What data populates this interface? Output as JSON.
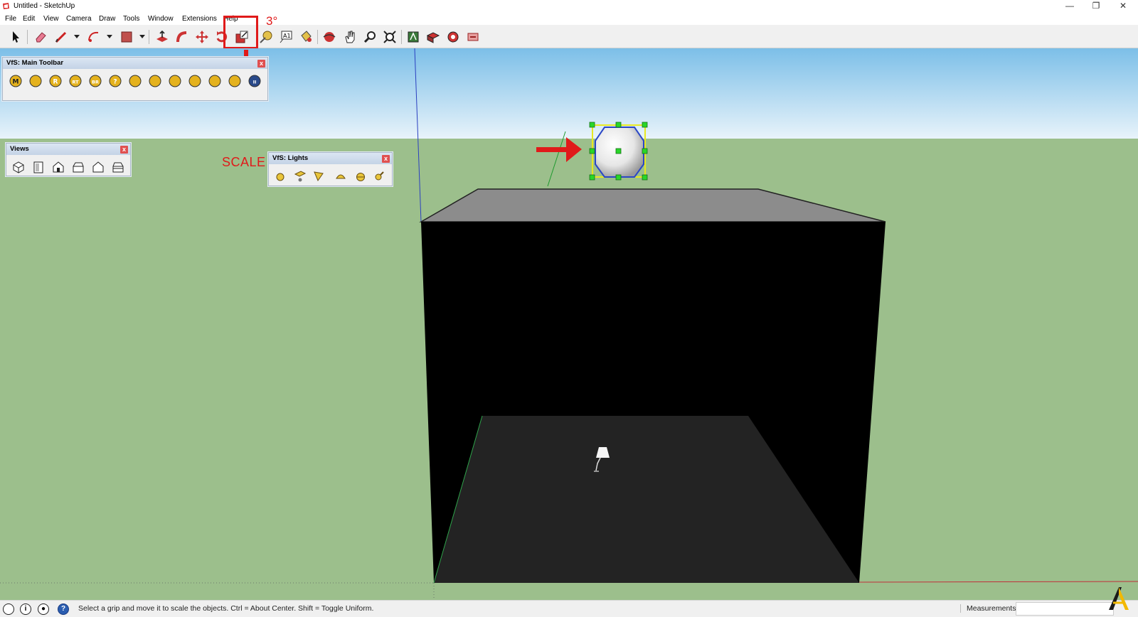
{
  "window": {
    "title": "Untitled - SketchUp",
    "controls": {
      "minimize": "—",
      "restore": "❐",
      "close": "✕"
    }
  },
  "menu": {
    "items": [
      "File",
      "Edit",
      "View",
      "Camera",
      "Draw",
      "Tools",
      "Window",
      "Extensions",
      "Help"
    ]
  },
  "toolbar": {
    "tools": [
      "select-tool",
      "eraser-tool",
      "line-tool",
      "arc-tool",
      "rectangle-tool",
      "push-pull-tool",
      "follow-me-tool",
      "move-tool",
      "rotate-tool",
      "scale-tool",
      "tape-measure-tool",
      "dimension-text-tool",
      "paint-bucket-tool",
      "orbit-tool",
      "pan-tool",
      "zoom-tool",
      "zoom-extents-tool",
      "warehouse-tool",
      "extension-warehouse-tool",
      "layout-tool",
      "send-to-layout-tool"
    ],
    "active_tool": "scale-tool"
  },
  "panels": {
    "vfs_main": {
      "title": "VfS: Main Toolbar",
      "close": "x",
      "buttons": [
        {
          "icon": "materials-icon",
          "glyph": "M"
        },
        {
          "icon": "tags-icon",
          "glyph": ""
        },
        {
          "icon": "render-icon",
          "glyph": "R"
        },
        {
          "icon": "render-region-icon",
          "glyph": "RT"
        },
        {
          "icon": "batch-render-icon",
          "glyph": "BR"
        },
        {
          "icon": "help-icon",
          "glyph": "?"
        },
        {
          "icon": "license-icon",
          "glyph": ""
        },
        {
          "icon": "sphere-icon",
          "glyph": ""
        },
        {
          "icon": "grass-icon",
          "glyph": ""
        },
        {
          "icon": "proxy-export-icon",
          "glyph": ""
        },
        {
          "icon": "proxy-import-icon",
          "glyph": ""
        },
        {
          "icon": "frame-buffer-icon",
          "glyph": ""
        },
        {
          "icon": "pause-icon",
          "glyph": "II"
        }
      ]
    },
    "views": {
      "title": "Views",
      "close": "x",
      "buttons": [
        "iso-view-icon",
        "top-view-icon",
        "front-view-icon",
        "right-view-icon",
        "back-view-icon",
        "left-view-icon"
      ]
    },
    "vfs_lights": {
      "title": "VfS: Lights",
      "close": "x",
      "buttons": [
        "omni-light-icon",
        "rect-light-icon",
        "spot-light-icon",
        "ies-light-icon",
        "dome-light-icon",
        "mesh-light-icon"
      ]
    }
  },
  "annotations": {
    "step_number": "3°",
    "scale_label": "SCALE",
    "highlight_color": "#e01a1a"
  },
  "scene": {
    "sky_color": "#a9d4ef",
    "ground_color": "#9cbf8c",
    "cube_color": "#000000",
    "floor_color": "#232323",
    "top_color": "#8c8c8c",
    "selection_color": "#1dd61d"
  },
  "status": {
    "hint": "Select a grip and move it to scale the objects. Ctrl = About Center. Shift = Toggle Uniform.",
    "measurements_label": "Measurements",
    "measurements_value": ""
  }
}
